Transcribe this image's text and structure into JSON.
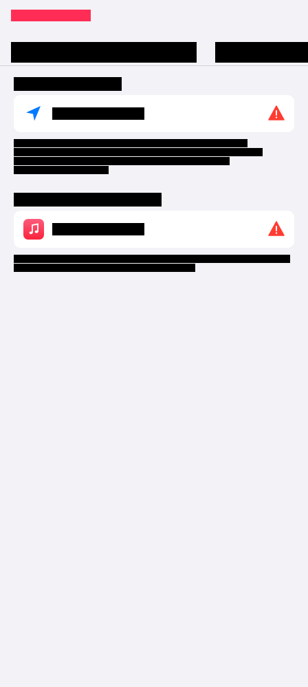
{
  "nav": {
    "back_label": "██████████"
  },
  "segments": [
    {
      "label": "████████████████████"
    },
    {
      "label": "██████████"
    }
  ],
  "sections": [
    {
      "header": "████████████",
      "row_label": "██████████",
      "description_lines": [
        "██ ▁███ █████ █████ ██ ████▖",
        "█████ ██████ █████ ████ ██",
        "█████ ███ ███ ███ ███████",
        "██████████"
      ]
    },
    {
      "header": "█▁▁▁███  ███████",
      "row_label": "██████████",
      "description_lines": [
        "██ ▁███ ██████ ████ ████ ██ █████",
        "██████ ███ █▁▁▁███ █████"
      ]
    }
  ],
  "colors": {
    "accent": "#ff2d55",
    "location": "#007aff",
    "warning": "#ff3b30",
    "background": "#f2f2f7",
    "card": "#ffffff"
  },
  "icons": {
    "section_1": "location-arrow-icon",
    "section_2": "music-app-icon",
    "status": "warning-triangle-icon"
  }
}
